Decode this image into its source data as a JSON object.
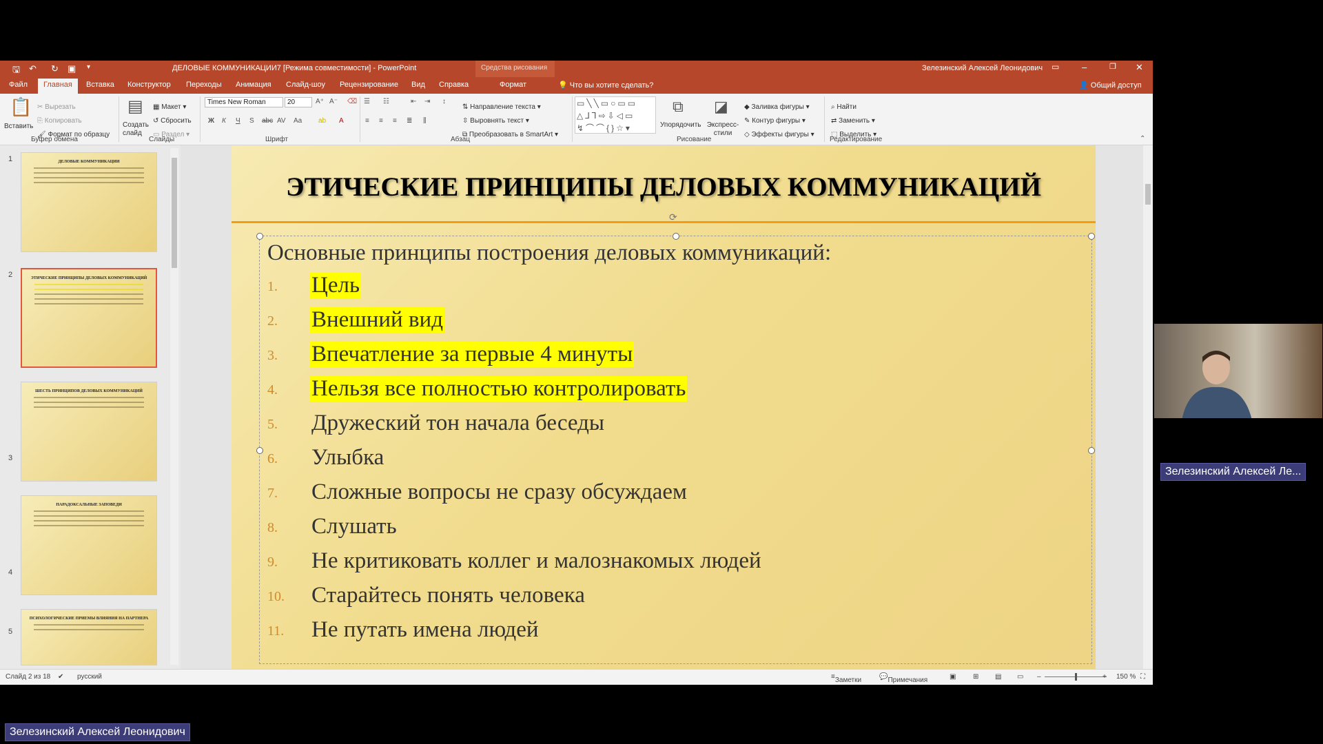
{
  "window": {
    "title": "ДЕЛОВЫЕ КОММУНИКАЦИИ7 [Режима совместимости]  -  PowerPoint",
    "context_tab": "Средства рисования",
    "user": "Зелезинский Алексей Леонидович"
  },
  "tabs": [
    "Файл",
    "Главная",
    "Вставка",
    "Конструктор",
    "Переходы",
    "Анимация",
    "Слайд-шоу",
    "Рецензирование",
    "Вид",
    "Справка",
    "Формат"
  ],
  "tell_me": "Что вы хотите сделать?",
  "share": "Общий доступ",
  "ribbon": {
    "paste": "Вставить",
    "cut": "Вырезать",
    "copy": "Копировать",
    "format_painter": "Формат по образцу",
    "new_slide": "Создать слайд",
    "layout": "Макет",
    "reset": "Сбросить",
    "section": "Раздел",
    "font_name": "Times New Roman",
    "font_size": "20",
    "text_direction": "Направление текста",
    "align_text": "Выровнять текст",
    "smartart": "Преобразовать в SmartArt",
    "arrange": "Упорядочить",
    "quick_styles": "Экспресс-стили",
    "shape_fill": "Заливка фигуры",
    "shape_outline": "Контур фигуры",
    "shape_effects": "Эффекты фигуры",
    "find": "Найти",
    "replace": "Заменить",
    "select": "Выделить",
    "groups": [
      "Буфер обмена",
      "Слайды",
      "Шрифт",
      "Абзац",
      "Рисование",
      "Редактирование"
    ]
  },
  "thumbnails": [
    {
      "num": "1",
      "title": "ДЕЛОВЫЕ КОММУНИКАЦИИ"
    },
    {
      "num": "2",
      "title": "ЭТИЧЕСКИЕ ПРИНЦИПЫ ДЕЛОВЫХ КОММУНИКАЦИЙ"
    },
    {
      "num": "3",
      "title": "ШЕСТЬ ПРИНЦИПОВ ДЕЛОВЫХ КОММУНИКАЦИЙ"
    },
    {
      "num": "4",
      "title": "ПАРАДОКСАЛЬНЫЕ ЗАПОВЕДИ"
    },
    {
      "num": "5",
      "title": "ПСИХОЛОГИЧЕСКИЕ ПРИЕМЫ ВЛИЯНИЯ НА ПАРТНЕРА"
    }
  ],
  "slide": {
    "title": "ЭТИЧЕСКИЕ ПРИНЦИПЫ ДЕЛОВЫХ КОММУНИКАЦИЙ",
    "subtitle": "Основные принципы построения деловых коммуникаций:",
    "items": [
      {
        "num": "1.",
        "text": "Цель",
        "highlight": true
      },
      {
        "num": "2.",
        "text": "Внешний вид",
        "highlight": true
      },
      {
        "num": "3.",
        "text": "Впечатление за первые 4 минуты",
        "highlight": true
      },
      {
        "num": "4.",
        "text": "Нельзя все полностью контролировать",
        "highlight": true
      },
      {
        "num": "5.",
        "text": "Дружеский тон начала беседы",
        "highlight": false
      },
      {
        "num": "6.",
        "text": "Улыбка",
        "highlight": false
      },
      {
        "num": "7.",
        "text": "Сложные вопросы не сразу обсуждаем",
        "highlight": false
      },
      {
        "num": "8.",
        "text": "Слушать",
        "highlight": false
      },
      {
        "num": "9.",
        "text": "Не критиковать коллег и малознакомых людей",
        "highlight": false
      },
      {
        "num": "10.",
        "text": "Старайтесь понять человека",
        "highlight": false
      },
      {
        "num": "11.",
        "text": "Не путать имена людей",
        "highlight": false
      }
    ]
  },
  "status": {
    "slide_info": "Слайд 2 из 18",
    "language": "русский",
    "notes": "Заметки",
    "comments": "Примечания",
    "zoom": "150 %"
  },
  "video": {
    "participant_name": "Зелезинский Алексей Ле...",
    "bottom_name": "Зелезинский Алексей Леонидович"
  },
  "colors": {
    "accent": "#b7472a",
    "highlight": "#ffff00",
    "number": "#d08a2a",
    "rule": "#f39c12"
  }
}
